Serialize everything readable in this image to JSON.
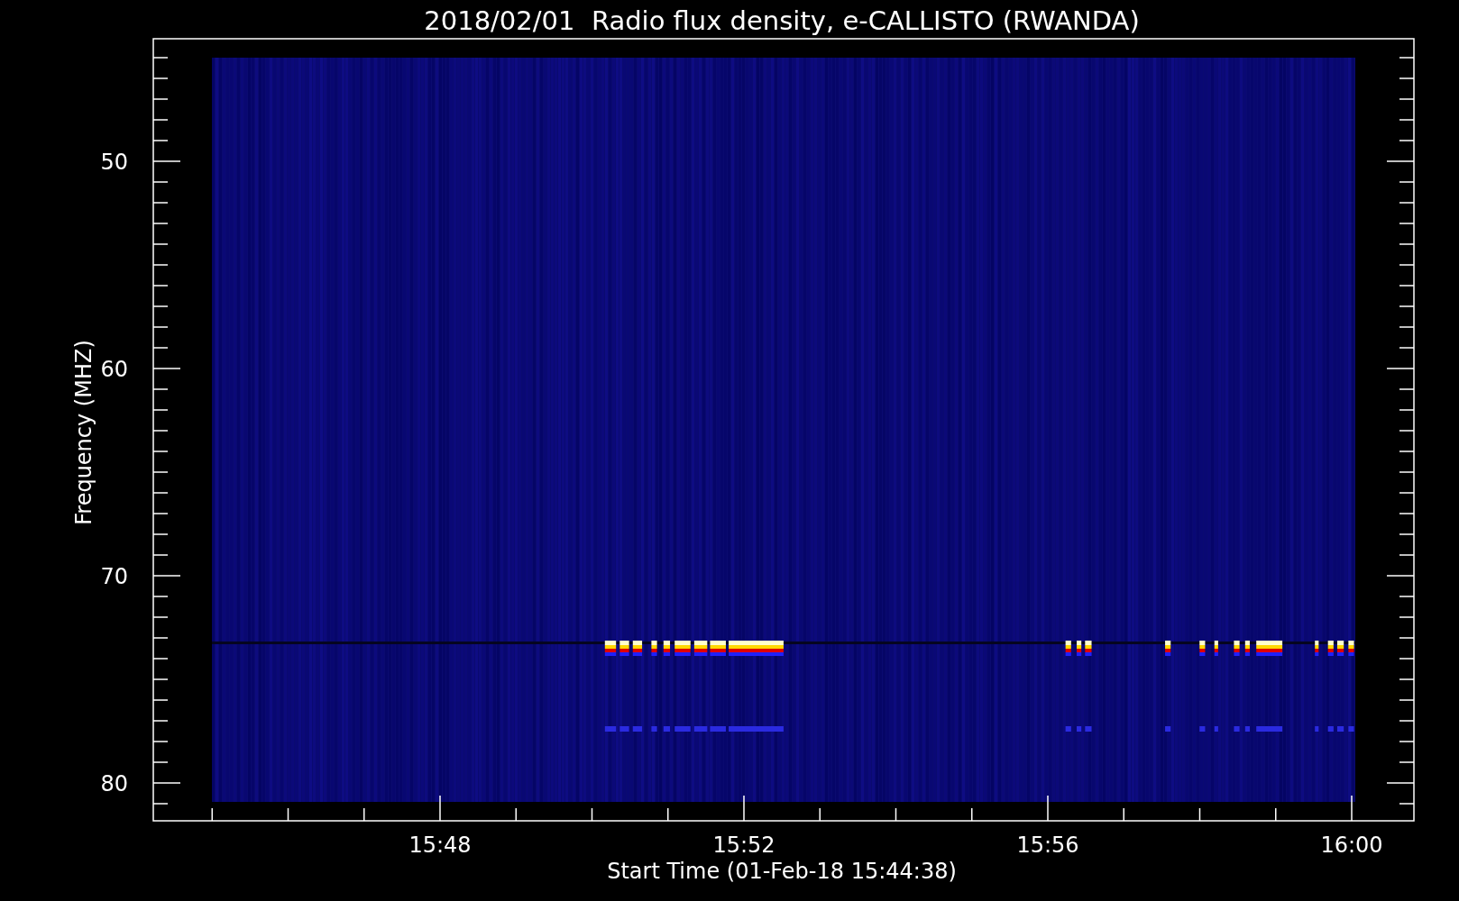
{
  "title": "2018/02/01  Radio flux density, e-CALLISTO (RWANDA)",
  "y_axis": {
    "label": "Frequency (MHZ)",
    "ticks": [
      "50",
      "60",
      "70",
      "80"
    ]
  },
  "x_axis": {
    "label": "Start Time (01-Feb-18 15:44:38)",
    "ticks": [
      "15:48",
      "15:52",
      "15:56",
      "16:00"
    ]
  }
}
